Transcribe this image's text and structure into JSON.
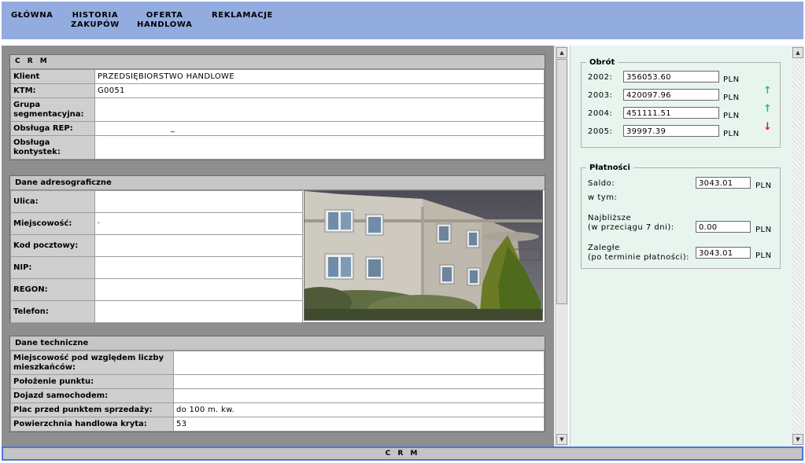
{
  "nav": {
    "items": [
      {
        "label": "GŁÓWNA"
      },
      {
        "label": "HISTORIA\nZAKUPÓW"
      },
      {
        "label": "OFERTA\nHANDLOWA"
      },
      {
        "label": "REKLAMACJE"
      }
    ]
  },
  "crm": {
    "title": "C R M",
    "fields": [
      {
        "label": "Klient",
        "value": "PRZEDSIĘBIORSTWO HANDLOWE"
      },
      {
        "label": "KTM:",
        "value": "G0051"
      },
      {
        "label": "Grupa segmentacyjna:",
        "value": ""
      },
      {
        "label": "Obsługa REP:",
        "value": "_"
      },
      {
        "label": "Obsługa kontystek:",
        "value": ""
      }
    ]
  },
  "address": {
    "title": "Dane adresograficzne",
    "fields": [
      {
        "label": "Ulica:",
        "value": ""
      },
      {
        "label": "Miejscowość:",
        "value": "·"
      },
      {
        "label": "Kod pocztowy:",
        "value": ""
      },
      {
        "label": "NIP:",
        "value": ""
      },
      {
        "label": "REGON:",
        "value": ""
      },
      {
        "label": "Telefon:",
        "value": ""
      }
    ]
  },
  "technical": {
    "title": "Dane techniczne",
    "fields": [
      {
        "label": "Miejscowość pod względem liczby mieszkańców:",
        "value": ""
      },
      {
        "label": "Położenie punktu:",
        "value": ""
      },
      {
        "label": "Dojazd samochodem:",
        "value": ""
      },
      {
        "label": "Plac przed punktem sprzedaży:",
        "value": "do 100 m. kw."
      },
      {
        "label": "Powierzchnia handlowa kryta:",
        "value": "53"
      }
    ]
  },
  "turnover": {
    "title": "Obrót",
    "unit": "PLN",
    "rows": [
      {
        "year": "2002:",
        "value": "356053.60",
        "trend": ""
      },
      {
        "year": "2003:",
        "value": "420097.96",
        "trend": "up"
      },
      {
        "year": "2004:",
        "value": "451111.51",
        "trend": "up"
      },
      {
        "year": "2005:",
        "value": "39997.39",
        "trend": "down"
      }
    ],
    "colors": {
      "up": "#22c55e",
      "down": "#e11d1d"
    }
  },
  "payments": {
    "title": "Płatności",
    "unit": "PLN",
    "saldo_label": "Saldo:",
    "saldo_value": "3043.01",
    "wtym_label": "w tym:",
    "nearest_label": "Najbliższe\n(w przeciągu 7 dni):",
    "nearest_value": "0.00",
    "overdue_label": "Zaległe\n(po terminie płatności):",
    "overdue_value": "3043.01"
  },
  "status": {
    "label": "C R M"
  },
  "icons": {
    "scroll_up": "▲",
    "scroll_down": "▼",
    "up_arrow": "↑",
    "down_arrow": "↓"
  }
}
